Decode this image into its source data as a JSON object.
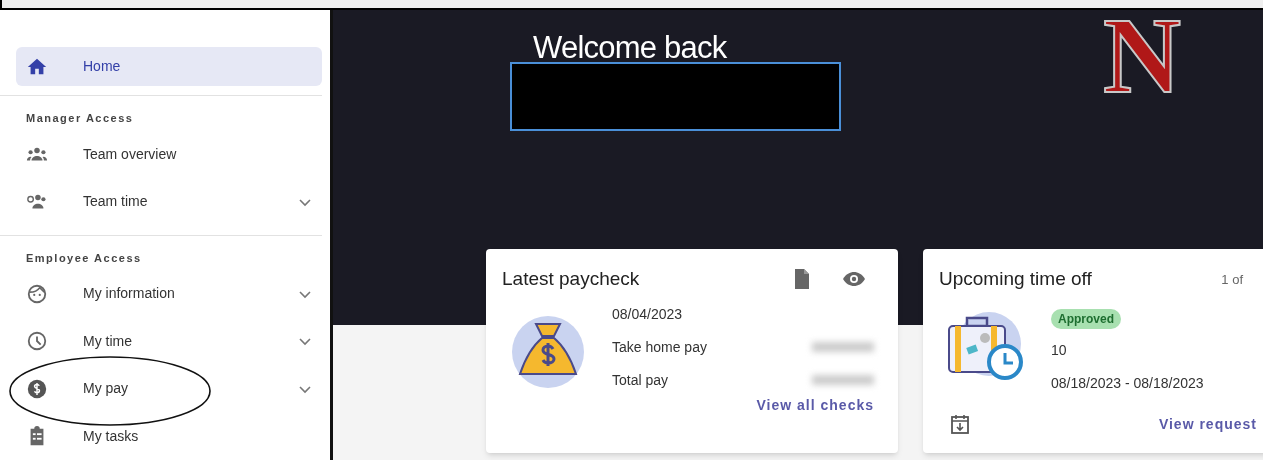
{
  "sidebar": {
    "home": {
      "label": "Home",
      "selected": true
    },
    "sections": [
      {
        "title": "Manager Access",
        "items": [
          {
            "label": "Team overview",
            "kind": "team",
            "expandable": false,
            "selected": false
          },
          {
            "label": "Team time",
            "kind": "teamtime",
            "expandable": true,
            "selected": false
          }
        ]
      },
      {
        "title": "Employee Access",
        "items": [
          {
            "label": "My information",
            "kind": "face",
            "expandable": true,
            "selected": false
          },
          {
            "label": "My time",
            "kind": "clock",
            "expandable": true,
            "selected": false
          },
          {
            "label": "My pay",
            "kind": "dollar",
            "expandable": true,
            "selected": false,
            "circled": true
          },
          {
            "label": "My tasks",
            "kind": "tasks",
            "expandable": false,
            "selected": false
          }
        ]
      }
    ]
  },
  "banner": {
    "greeting": "Welcome back",
    "logo": "N"
  },
  "paycheck_card": {
    "title": "Latest paycheck",
    "date": "08/04/2023",
    "rows": [
      {
        "label": "Take home pay"
      },
      {
        "label": "Total pay"
      }
    ],
    "link": "View all checks"
  },
  "time_off_card": {
    "title": "Upcoming time off",
    "pager": "1 of",
    "status": "Approved",
    "hours": "10",
    "dates": "08/18/2023 - 08/18/2023",
    "link": "View request"
  }
}
